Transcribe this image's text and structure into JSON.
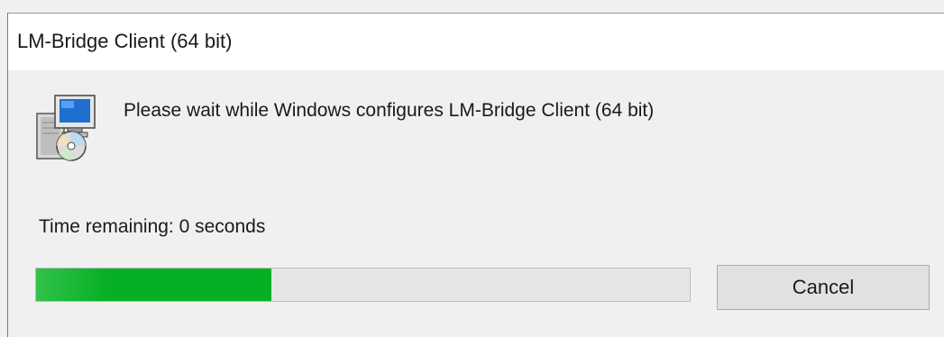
{
  "window": {
    "title": "LM-Bridge Client (64 bit)"
  },
  "icon": {
    "name": "installer-icon"
  },
  "message": "Please wait while Windows configures LM-Bridge Client (64 bit)",
  "status": {
    "time_remaining": "Time remaining: 0 seconds"
  },
  "progress": {
    "fraction": 0.36,
    "color": "#06b025"
  },
  "buttons": {
    "cancel_label": "Cancel"
  }
}
